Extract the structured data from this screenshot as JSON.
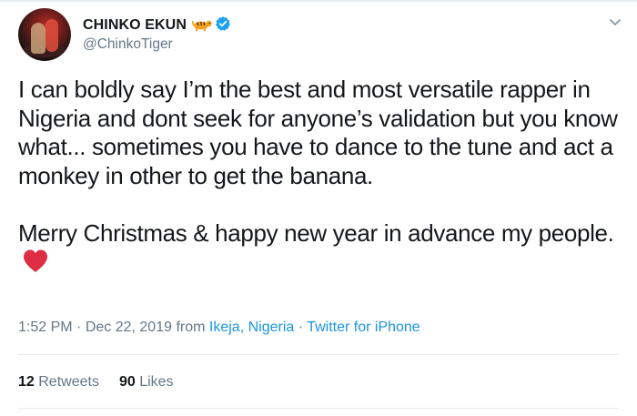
{
  "user": {
    "display_name": "CHINKO EKUN",
    "handle": "@ChinkoTiger"
  },
  "icons": {
    "name_emoji": "tiger-icon",
    "verified": "verified-badge-icon",
    "heart": "red-heart-icon",
    "more": "chevron-down-icon"
  },
  "tweet": {
    "paragraph_1": "I can boldly say I’m the best and most versatile rapper in Nigeria and dont seek for anyone’s validation but you know what... sometimes you have to dance to the tune and act a monkey in other to get the banana.",
    "paragraph_2": "Merry Christmas & happy new year in advance my people."
  },
  "meta": {
    "time": "1:52 PM",
    "separator": " · ",
    "date": "Dec 22, 2019",
    "from_label": " from ",
    "location": "Ikeja, Nigeria",
    "client": "Twitter for iPhone"
  },
  "stats": {
    "retweets_count": "12",
    "retweets_label": "Retweets",
    "likes_count": "90",
    "likes_label": "Likes"
  },
  "colors": {
    "text": "#14171a",
    "secondary": "#657786",
    "link": "#1b95e0",
    "verified": "#1da1f2",
    "heart": "#dd2e44",
    "divider": "#e6ecf0"
  }
}
